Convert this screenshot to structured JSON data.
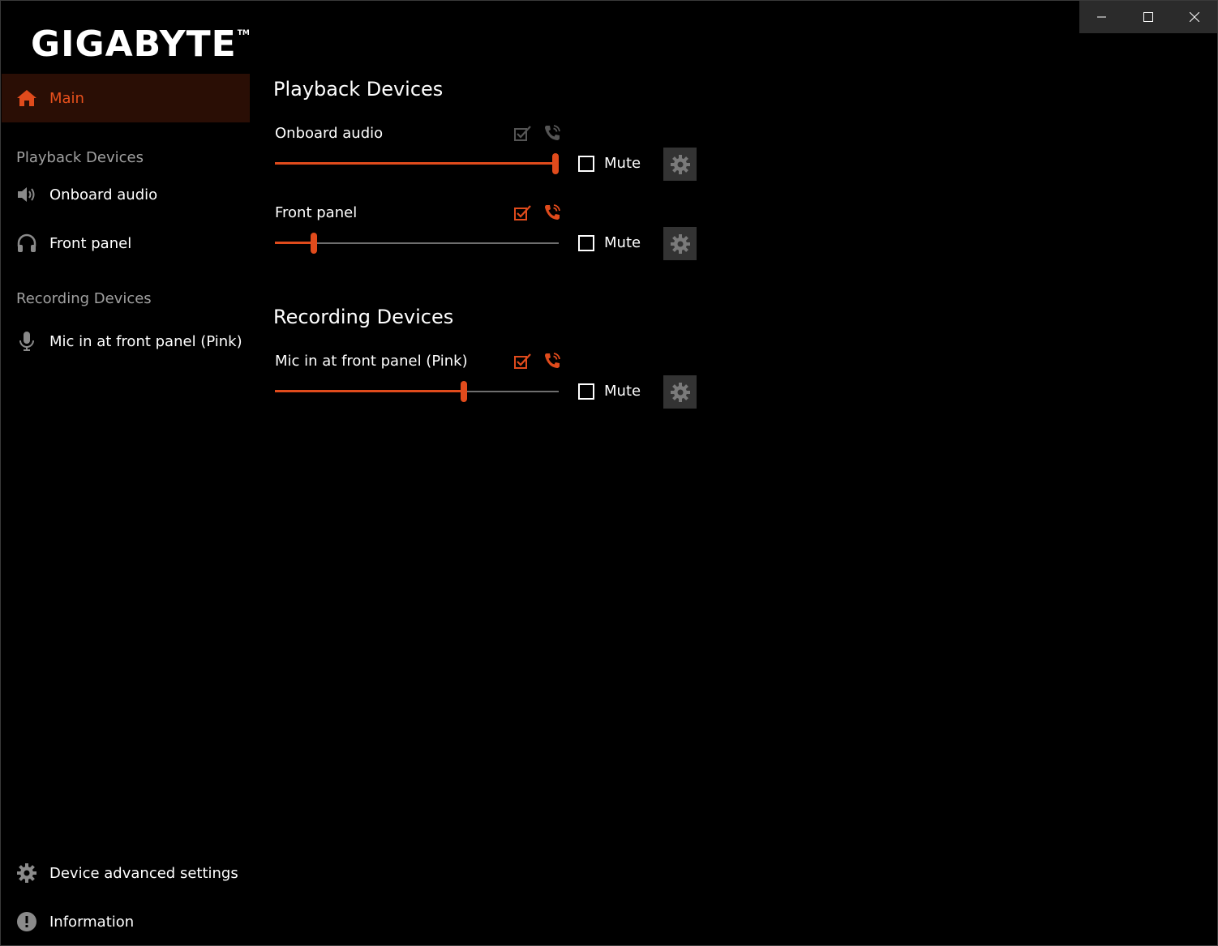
{
  "brand": {
    "logo": "GIGABYTE",
    "tm": "TM",
    "accent": "#e04b1c"
  },
  "window_controls": {
    "minimize": "minimize-icon",
    "maximize": "maximize-icon",
    "close": "close-icon"
  },
  "sidebar": {
    "main": {
      "label": "Main",
      "icon": "home-icon"
    },
    "playback_title": "Playback Devices",
    "playback_items": [
      {
        "label": "Onboard audio",
        "icon": "speaker-icon"
      },
      {
        "label": "Front panel",
        "icon": "headphones-icon"
      }
    ],
    "recording_title": "Recording Devices",
    "recording_items": [
      {
        "label": "Mic in at front panel (Pink)",
        "icon": "microphone-icon"
      }
    ],
    "bottom_items": [
      {
        "label": "Device advanced settings",
        "icon": "gear-icon"
      },
      {
        "label": "Information",
        "icon": "info-icon"
      }
    ]
  },
  "main": {
    "playback_title": "Playback Devices",
    "recording_title": "Recording Devices",
    "devices": [
      {
        "name": "Onboard audio",
        "volume": 1.0,
        "default_device": false,
        "default_comm": false,
        "mute_label": "Mute",
        "muted": false
      },
      {
        "name": "Front panel",
        "volume": 0.13,
        "default_device": true,
        "default_comm": true,
        "mute_label": "Mute",
        "muted": false
      },
      {
        "name": "Mic in at front panel (Pink)",
        "volume": 0.67,
        "default_device": true,
        "default_comm": true,
        "mute_label": "Mute",
        "muted": false
      }
    ]
  }
}
